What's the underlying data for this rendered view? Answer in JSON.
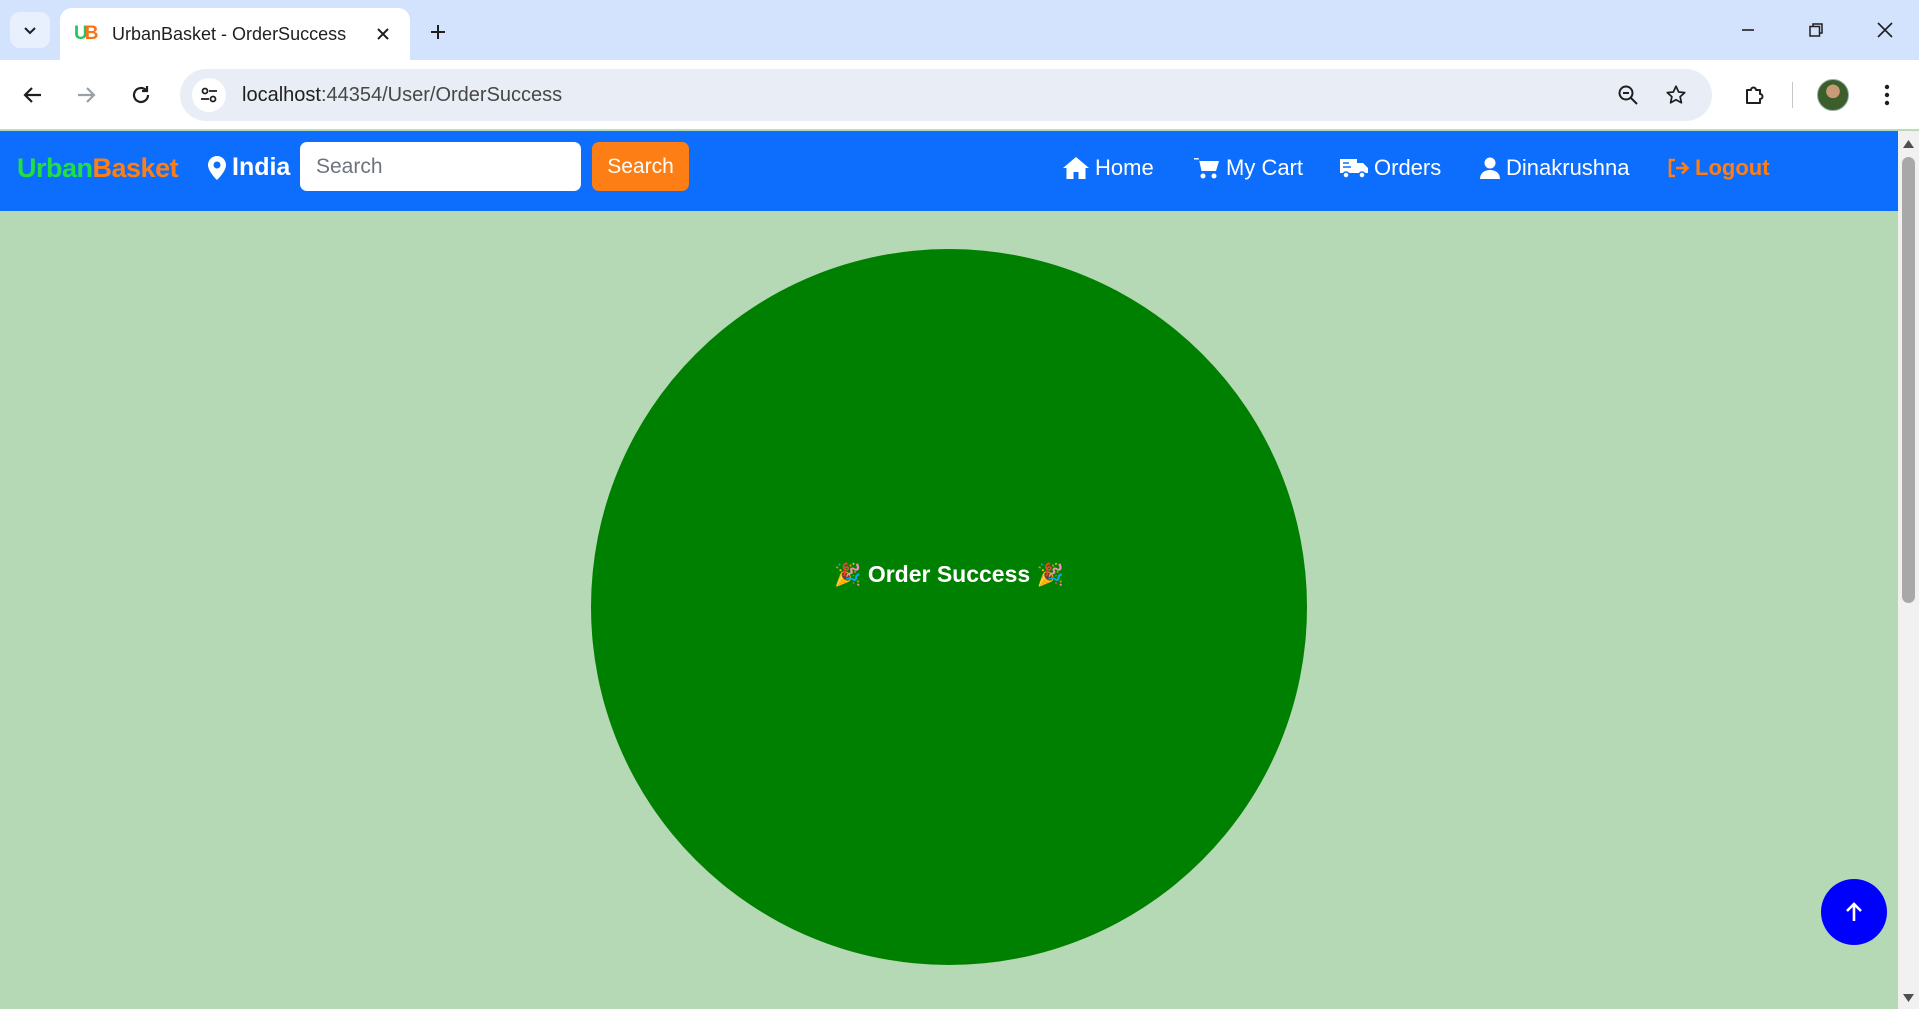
{
  "browser": {
    "tab_title": "UrbanBasket - OrderSuccess",
    "favicon_text": "UB",
    "url_host": "localhost",
    "url_rest": ":44354/User/OrderSuccess"
  },
  "navbar": {
    "brand_urban": "Urban",
    "brand_basket": "Basket",
    "location": "India",
    "search_placeholder": "Search",
    "search_button": "Search",
    "links": {
      "home": "Home",
      "cart": "My Cart",
      "orders": "Orders",
      "user": "Dinakrushna",
      "logout": "Logout"
    }
  },
  "main": {
    "party_icon": "🎉",
    "message": "Order Success"
  },
  "colors": {
    "navbar": "#0d6efd",
    "accent_orange": "#fd7e14",
    "brand_green": "#22dd44",
    "page_bg": "#b4d9b4",
    "circle": "#008000",
    "scroll_top_button": "#0000ff"
  },
  "icons": {
    "location": "map-pin-icon",
    "home": "house-icon",
    "cart": "cart-icon",
    "orders": "truck-icon",
    "user": "user-icon",
    "logout": "sign-out-icon",
    "scroll_top": "arrow-up-icon"
  }
}
